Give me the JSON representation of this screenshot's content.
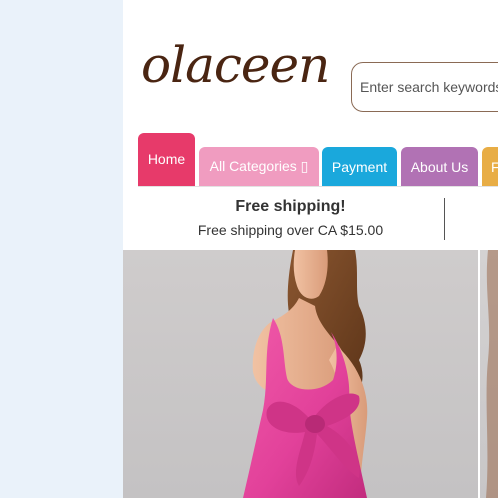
{
  "brand": {
    "logo_text": "olaceen"
  },
  "search": {
    "placeholder": "Enter search keywords here"
  },
  "nav": {
    "tabs": [
      {
        "label": "Home",
        "color": "#e73a6a",
        "active": true
      },
      {
        "label": "All Categories ▯",
        "color": "#f09cc0"
      },
      {
        "label": "Payment",
        "color": "#1aa8dc"
      },
      {
        "label": "About Us",
        "color": "#b172b4"
      },
      {
        "label": "F",
        "color": "#e8ad45"
      }
    ]
  },
  "promo": {
    "title": "Free shipping!",
    "subtitle": "Free shipping over CA $15.00"
  },
  "hero": {
    "image": "model-in-pink-satin-gown-with-bow"
  },
  "colors": {
    "background": "#eaf2fa",
    "logo": "#4a2512",
    "dress": "#e9469a"
  }
}
